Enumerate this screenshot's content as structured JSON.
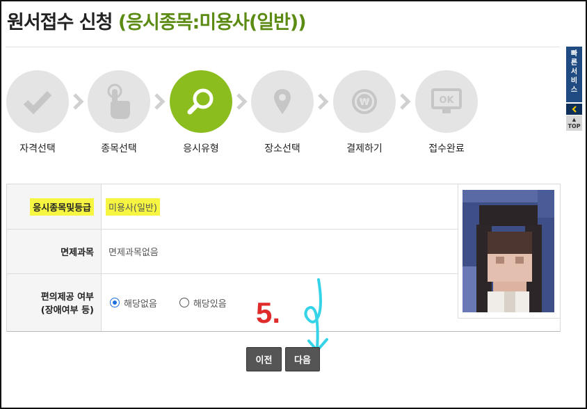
{
  "header": {
    "title": "원서접수 신청",
    "subtitle": "(응시종목:미용사(일반))"
  },
  "quick_menu": {
    "label_chars": [
      "빠",
      "른",
      "서",
      "비",
      "스"
    ],
    "top_label": "TOP"
  },
  "steps": [
    {
      "label": "자격선택",
      "icon": "check-icon",
      "active": false
    },
    {
      "label": "종목선택",
      "icon": "hand-pointer-icon",
      "active": false
    },
    {
      "label": "응시유형",
      "icon": "search-icon",
      "active": true
    },
    {
      "label": "장소선택",
      "icon": "location-pin-icon",
      "active": false
    },
    {
      "label": "결제하기",
      "icon": "won-coin-icon",
      "active": false
    },
    {
      "label": "접수완료",
      "icon": "ok-monitor-icon",
      "active": false
    }
  ],
  "form": {
    "category_label": "응시종목및등급",
    "category_value": "미용사(일반)",
    "exemption_label": "면제과목",
    "exemption_value": "면제과목없음",
    "accommodation_label_line1": "편의제공 여부",
    "accommodation_label_line2": "(장애여부 등)",
    "options": [
      {
        "label": "해당없음",
        "selected": true
      },
      {
        "label": "해당있음",
        "selected": false
      }
    ]
  },
  "annotation": {
    "step_number": "5."
  },
  "buttons": {
    "prev": "이전",
    "next": "다음"
  },
  "colors": {
    "accent_green": "#8bbd1e",
    "title_green": "#5c8b14",
    "highlight": "#f5f542",
    "annotation_red": "#e02b2b",
    "annotation_cyan": "#35d3e8"
  }
}
